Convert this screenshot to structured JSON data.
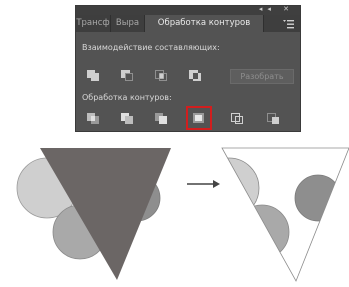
{
  "panel": {
    "window_controls": "◂◂ ✕",
    "tabs": [
      {
        "label": "Трансф",
        "active": false
      },
      {
        "label": "Выра",
        "active": false
      },
      {
        "label": "Обработка контуров",
        "active": true
      }
    ],
    "menu_icon": "menu-lines-icon",
    "shape_modes_label": "Взаимодействие составляющих:",
    "shape_mode_icons": [
      "unite-icon",
      "minus-front-icon",
      "intersect-icon",
      "exclude-icon"
    ],
    "split_button_label": "Разобрать",
    "pathfinders_label": "Обработка контуров:",
    "pathfinder_icons": [
      "divide-icon",
      "trim-icon",
      "merge-icon",
      "crop-icon",
      "outline-icon",
      "minus-back-icon"
    ],
    "selected_pathfinder": "crop-icon"
  },
  "illustration": {
    "arrow": "→",
    "colors": {
      "triangle": "#6b6665",
      "circle_large": "#c9c9c9",
      "circle_mid": "#a9a9a9",
      "circle_dark": "#8e8e8e",
      "outline": "#7a7a7a"
    }
  }
}
